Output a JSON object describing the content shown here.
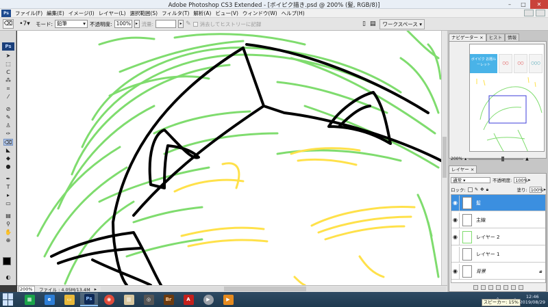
{
  "window": {
    "title": "Adobe Photoshop CS3 Extended - [ボイピク描き.psd @ 200% (髪, RGB/8)]",
    "minimize": "–",
    "maximize": "□",
    "close": "✕"
  },
  "menu": {
    "logo": "Ps",
    "items": [
      "ファイル(F)",
      "編集(E)",
      "イメージ(I)",
      "レイヤー(L)",
      "選択範囲(S)",
      "フィルタ(T)",
      "解析(A)",
      "ビュー(V)",
      "ウィンドウ(W)",
      "ヘルプ(H)"
    ]
  },
  "options": {
    "brush_size": "7",
    "mode_label": "モード:",
    "mode_value": "鉛筆",
    "opacity_label": "不透明度:",
    "opacity_value": "100%",
    "flow_label": "流量:",
    "flow_value": "",
    "history_label": "消去してヒストリーに記録",
    "workspace_label": "ワークスペース"
  },
  "tools": {
    "logo": "Ps"
  },
  "status": {
    "zoom": "200%",
    "file_info": "ファイル : 4.05M/13.4M"
  },
  "navigator": {
    "tabs": [
      "ナビゲーター",
      "ヒスト",
      "情報"
    ],
    "banner_main": "ボイピク お題ルーレット",
    "banner_items": [
      "〇〇",
      "〇〇",
      "〇〇〇"
    ],
    "zoom": "200%"
  },
  "layers": {
    "tab": "レイヤー",
    "blend_mode": "通常",
    "opacity_label": "不透明度:",
    "opacity_value": "100%",
    "lock_label": "ロック:",
    "fill_label": "塗り:",
    "fill_value": "100%",
    "list": [
      {
        "name": "髪",
        "visible": true,
        "active": true
      },
      {
        "name": "主線",
        "visible": true,
        "active": false
      },
      {
        "name": "レイヤー 2",
        "visible": true,
        "active": false
      },
      {
        "name": "レイヤー 1",
        "visible": false,
        "active": false
      },
      {
        "name": "背景",
        "visible": true,
        "active": false,
        "locked": true
      }
    ]
  },
  "taskbar": {
    "apps": [
      "Ps",
      "Br"
    ],
    "time": "12:46",
    "date": "2019/08/29",
    "tooltip": "スピーカー: 15%"
  },
  "colors": {
    "sketch_green": "#7fdc6e",
    "sketch_yellow": "#ffe14a",
    "line_black": "#000000",
    "active_layer": "#3b8fe0"
  }
}
